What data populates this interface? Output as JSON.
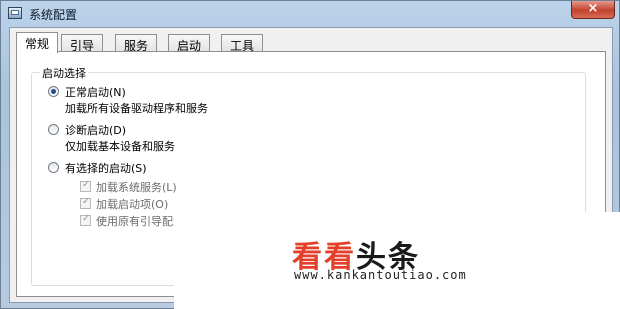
{
  "window": {
    "title": "系统配置",
    "close_glyph": "×"
  },
  "tabs": [
    "常规",
    "引导",
    "服务",
    "启动",
    "工具"
  ],
  "startup_group": {
    "label": "启动选择",
    "normal": {
      "label": "正常启动(N)",
      "desc": "加载所有设备驱动程序和服务",
      "checked": true
    },
    "diagnostic": {
      "label": "诊断启动(D)",
      "desc": "仅加载基本设备和服务",
      "checked": false
    },
    "selective": {
      "label": "有选择的启动(S)",
      "checked": false,
      "options": [
        {
          "label": "加载系统服务(L)",
          "checked": true
        },
        {
          "label": "加载启动项(O)",
          "checked": true
        },
        {
          "label": "使用原有引导配置",
          "checked": true
        }
      ]
    }
  },
  "watermark": {
    "logo_part1": "看看",
    "logo_part2": "头条",
    "url": "www.kankantoutiao.com"
  },
  "icons": {
    "app": "msconfig-window-icon",
    "close": "close-icon",
    "check": "check-icon"
  }
}
